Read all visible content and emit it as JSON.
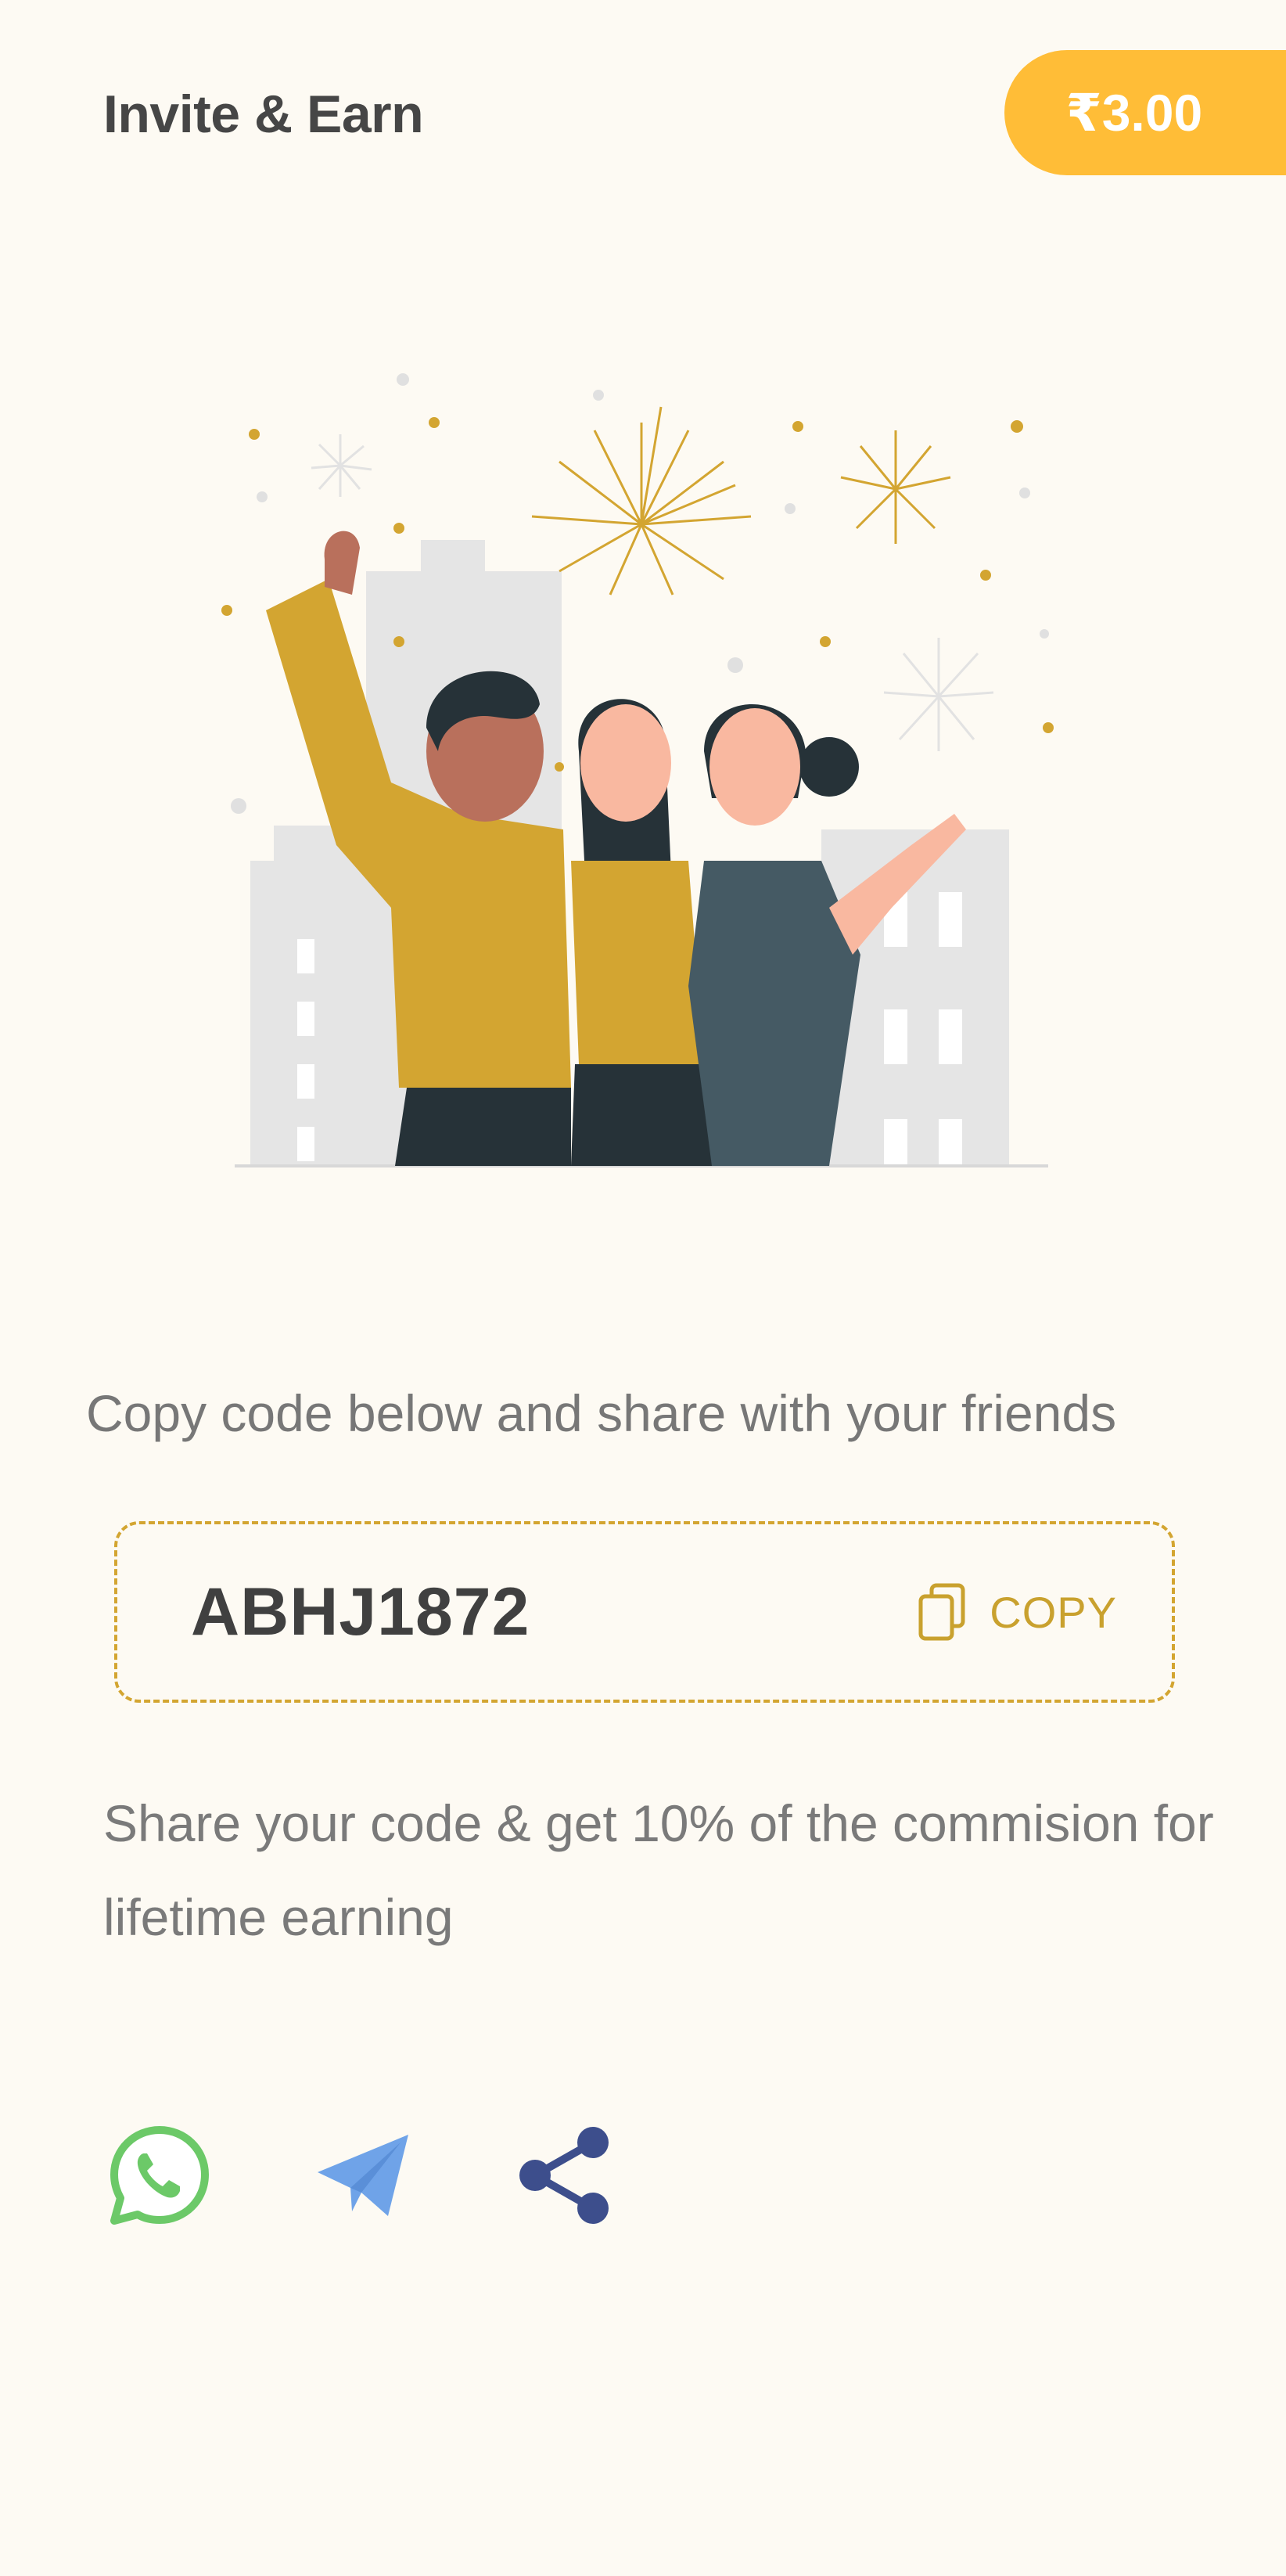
{
  "header": {
    "title": "Invite & Earn",
    "balance": "₹3.00"
  },
  "main": {
    "instruction": "Copy code below and share with your friends",
    "referral_code": "ABHJ1872",
    "copy_label": "COPY",
    "commission_text": "Share your code & get 10% of the commision for lifetime earning"
  },
  "share_options": [
    "whatsapp-icon",
    "telegram-icon",
    "share-icon"
  ],
  "colors": {
    "background": "#FDFAF3",
    "balance_pill": "#FFBD37",
    "accent_gold": "#D3A531",
    "whatsapp": "#6CC968",
    "telegram": "#6FA3E8",
    "share": "#3D4E8C"
  }
}
